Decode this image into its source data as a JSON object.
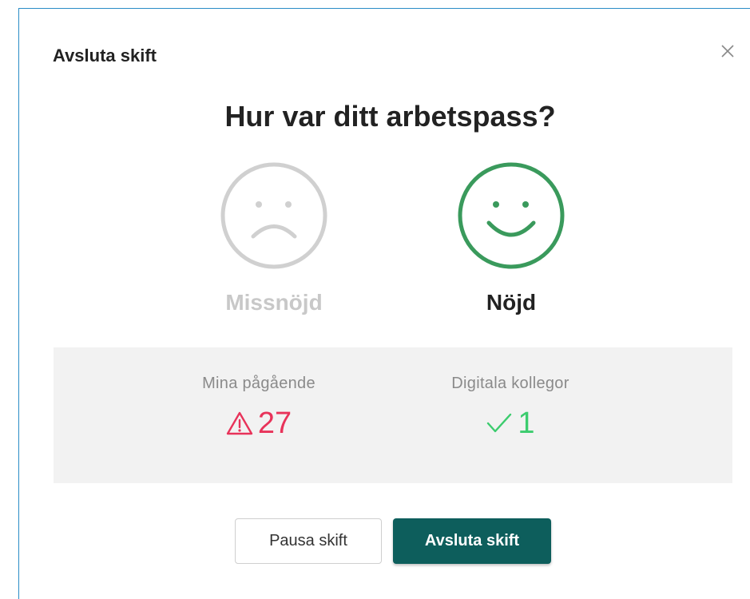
{
  "modal": {
    "title": "Avsluta skift",
    "question": "Hur var ditt arbetspass?"
  },
  "ratings": [
    {
      "label": "Missnöjd",
      "icon": "sad-face-icon",
      "selected": false,
      "color": "#c8c8c8"
    },
    {
      "label": "Nöjd",
      "icon": "happy-face-icon",
      "selected": true,
      "color": "#3a9a5c"
    }
  ],
  "stats": {
    "ongoing": {
      "label": "Mina pågående",
      "value": "27",
      "icon": "warning-triangle-icon",
      "color": "#e8335a"
    },
    "colleagues": {
      "label": "Digitala kollegor",
      "value": "1",
      "icon": "checkmark-icon",
      "color": "#3ccc6e"
    }
  },
  "buttons": {
    "pause_label": "Pausa skift",
    "end_label": "Avsluta skift"
  },
  "colors": {
    "accent": "#0d5e5c",
    "border": "#2a8cc6"
  }
}
